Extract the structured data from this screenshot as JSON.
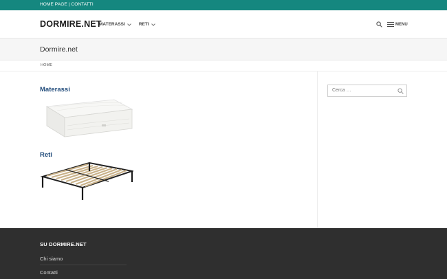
{
  "topbar": {
    "home_label": "HOME PAGE",
    "separator": "|",
    "contacts_label": "CONTATTI"
  },
  "header": {
    "brand": "DORMIRE.NET",
    "nav": [
      {
        "label": "MATERASSI"
      },
      {
        "label": "RETI"
      }
    ],
    "menu_label": "MENU"
  },
  "page": {
    "title": "Dormire.net"
  },
  "breadcrumb": {
    "home": "HOME"
  },
  "categories": [
    {
      "title": "Materassi",
      "image": "mattress-image"
    },
    {
      "title": "Reti",
      "image": "slatted-bed-base-image"
    }
  ],
  "sidebar": {
    "search_placeholder": "Cerca …"
  },
  "footer": {
    "heading": "SU DORMIRE.NET",
    "links": [
      {
        "label": "Chi siamo"
      },
      {
        "label": "Contatti"
      }
    ]
  },
  "colors": {
    "topbar": "#15877f",
    "category_title": "#1f4a7a",
    "footer_bg": "#2f2f2f"
  }
}
